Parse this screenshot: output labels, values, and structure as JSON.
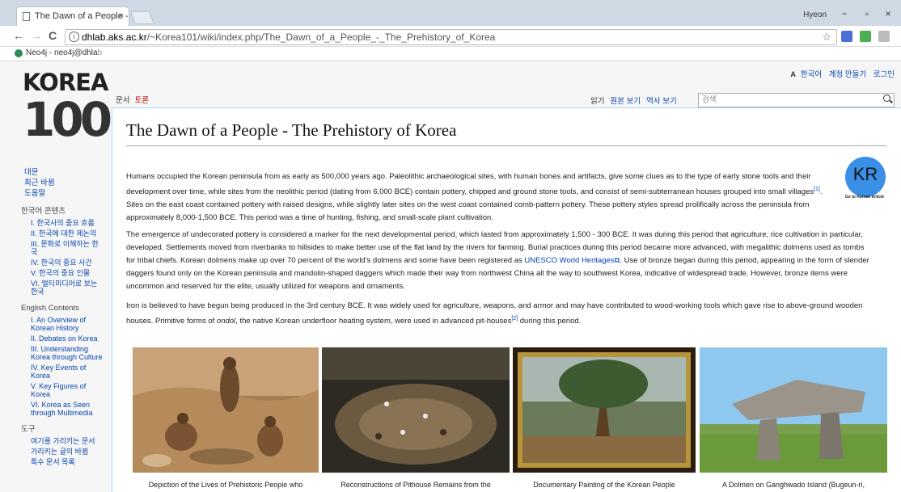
{
  "browser": {
    "tab_title": "The Dawn of a People - ",
    "tab_close": "×",
    "window_user": "Hyeon",
    "minimize": "−",
    "restore": "▫",
    "close": "×",
    "back": "←",
    "forward": "→",
    "reload": "C",
    "address_host": "dhlab.aks.ac.kr",
    "address_path": "/~Korea101/wiki/index.php/The_Dawn_of_a_People_-_The_Prehistory_of_Korea",
    "bookmark_label": "Neo4j - neo4j@dhla",
    "bookmark_fade": "b"
  },
  "logo": {
    "line1": "KOREA",
    "line2": "100"
  },
  "personal": {
    "lang": "A",
    "korean": "한국어",
    "create_account": "계정 만들기",
    "login": "로그인"
  },
  "page_tabs": {
    "article": "문서",
    "talk": "토론",
    "read": "읽기",
    "view_source": "원본 보기",
    "history": "역사 보기"
  },
  "search": {
    "placeholder": "검색"
  },
  "sidebar": {
    "main": [
      "대문",
      "최근 바뀜",
      "도움말"
    ],
    "korean_heading": "한국어 콘텐츠",
    "korean_items": [
      "I. 한국사의 중요 흐름",
      "II. 한국에 대한 제논의",
      "III. 문화로 이해하는 한국",
      "IV. 한국의 중요 사건",
      "V. 한국의 중요 인물",
      "VI. 멀티미디어로 보는 한국"
    ],
    "english_heading": "English Contents",
    "english_items": [
      "I. An Overview of Korean History",
      "II. Debates on Korea",
      "III. Understanding Korea through Culture",
      "IV. Key Events of Korea",
      "V. Key Figures of Korea",
      "VI. Korea as Seen through Multimedia"
    ],
    "tools_heading": "도구",
    "tools_items": [
      "여기를 가리키는 문서",
      "가리키는 글의 바뀜",
      "특수 문서 목록"
    ]
  },
  "article": {
    "title": "The Dawn of a People - The Prehistory of Korea",
    "badge": "KR",
    "badge_caption": "Go to Korean Article",
    "p1_a": "Humans occupied the Korean peninsula from as early as 500,000 years ago. Paleolithic archaeological sites, with human bones and artifacts, give some clues as to the type of early stone tools and their development over time, while sites from the neolithic period (dating from 6,000 BCE) contain pottery, chipped and ground stone tools, and consist of semi-subterranean houses grouped into small villages",
    "p1_ref": "[1]",
    "p1_b": ". Sites on the east coast contained pottery with raised designs, while slightly later sites on the west coast contained comb-pattern pottery. These pottery styles spread prolifically across the peninsula from approximately 8,000-1,500 BCE. This period was a time of hunting, fishing, and small-scale plant cultivation.",
    "p2_a": "The emergence of undecorated pottery is considered a marker for the next developmental period, which lasted from approximately 1,500 - 300 BCE. It was during this period that agriculture, rice cultivation in particular, developed. Settlements moved from riverbanks to hillsides to make better use of the flat land by the rivers for farming. Burial practices during this period became more advanced, with megalithic dolmens used as tombs for tribal chiefs. Korean dolmens make up over 70 percent of the world's dolmens and some have been registered as ",
    "p2_link": "UNESCO World Heritages",
    "p2_b": ". Use of bronze began during this period, appearing in the form of slender daggers found only on the Korean peninsula and mandolin-shaped daggers which made their way from northwest China all the way to southwest Korea, indicative of widespread trade. However, bronze items were uncommon and reserved for the elite, usually utilized for weapons and ornaments.",
    "p3_a": "Iron is believed to have begun being produced in the 3rd century BCE. It was widely used for agriculture, weapons, and armor and may have contributed to wood-working tools which gave rise to above-ground wooden houses. Primitive forms of ",
    "p3_em": "ondol",
    "p3_b": ", the native Korean underfloor heating system, were used in advanced pit-houses",
    "p3_ref": "[2]",
    "p3_c": " during this period."
  },
  "figures": [
    "Depiction of the Lives of Prehistoric People who",
    "Reconstructions of Pithouse Remains from the",
    "Documentary Painting of the Korean People",
    "A Dolmen on Ganghwado Island (Bugeun-ri,"
  ],
  "colors": {
    "link": "#0645ad",
    "talk_red": "#ba0000",
    "content_border": "#a7d7f9",
    "badge": "#3a8fe6"
  }
}
